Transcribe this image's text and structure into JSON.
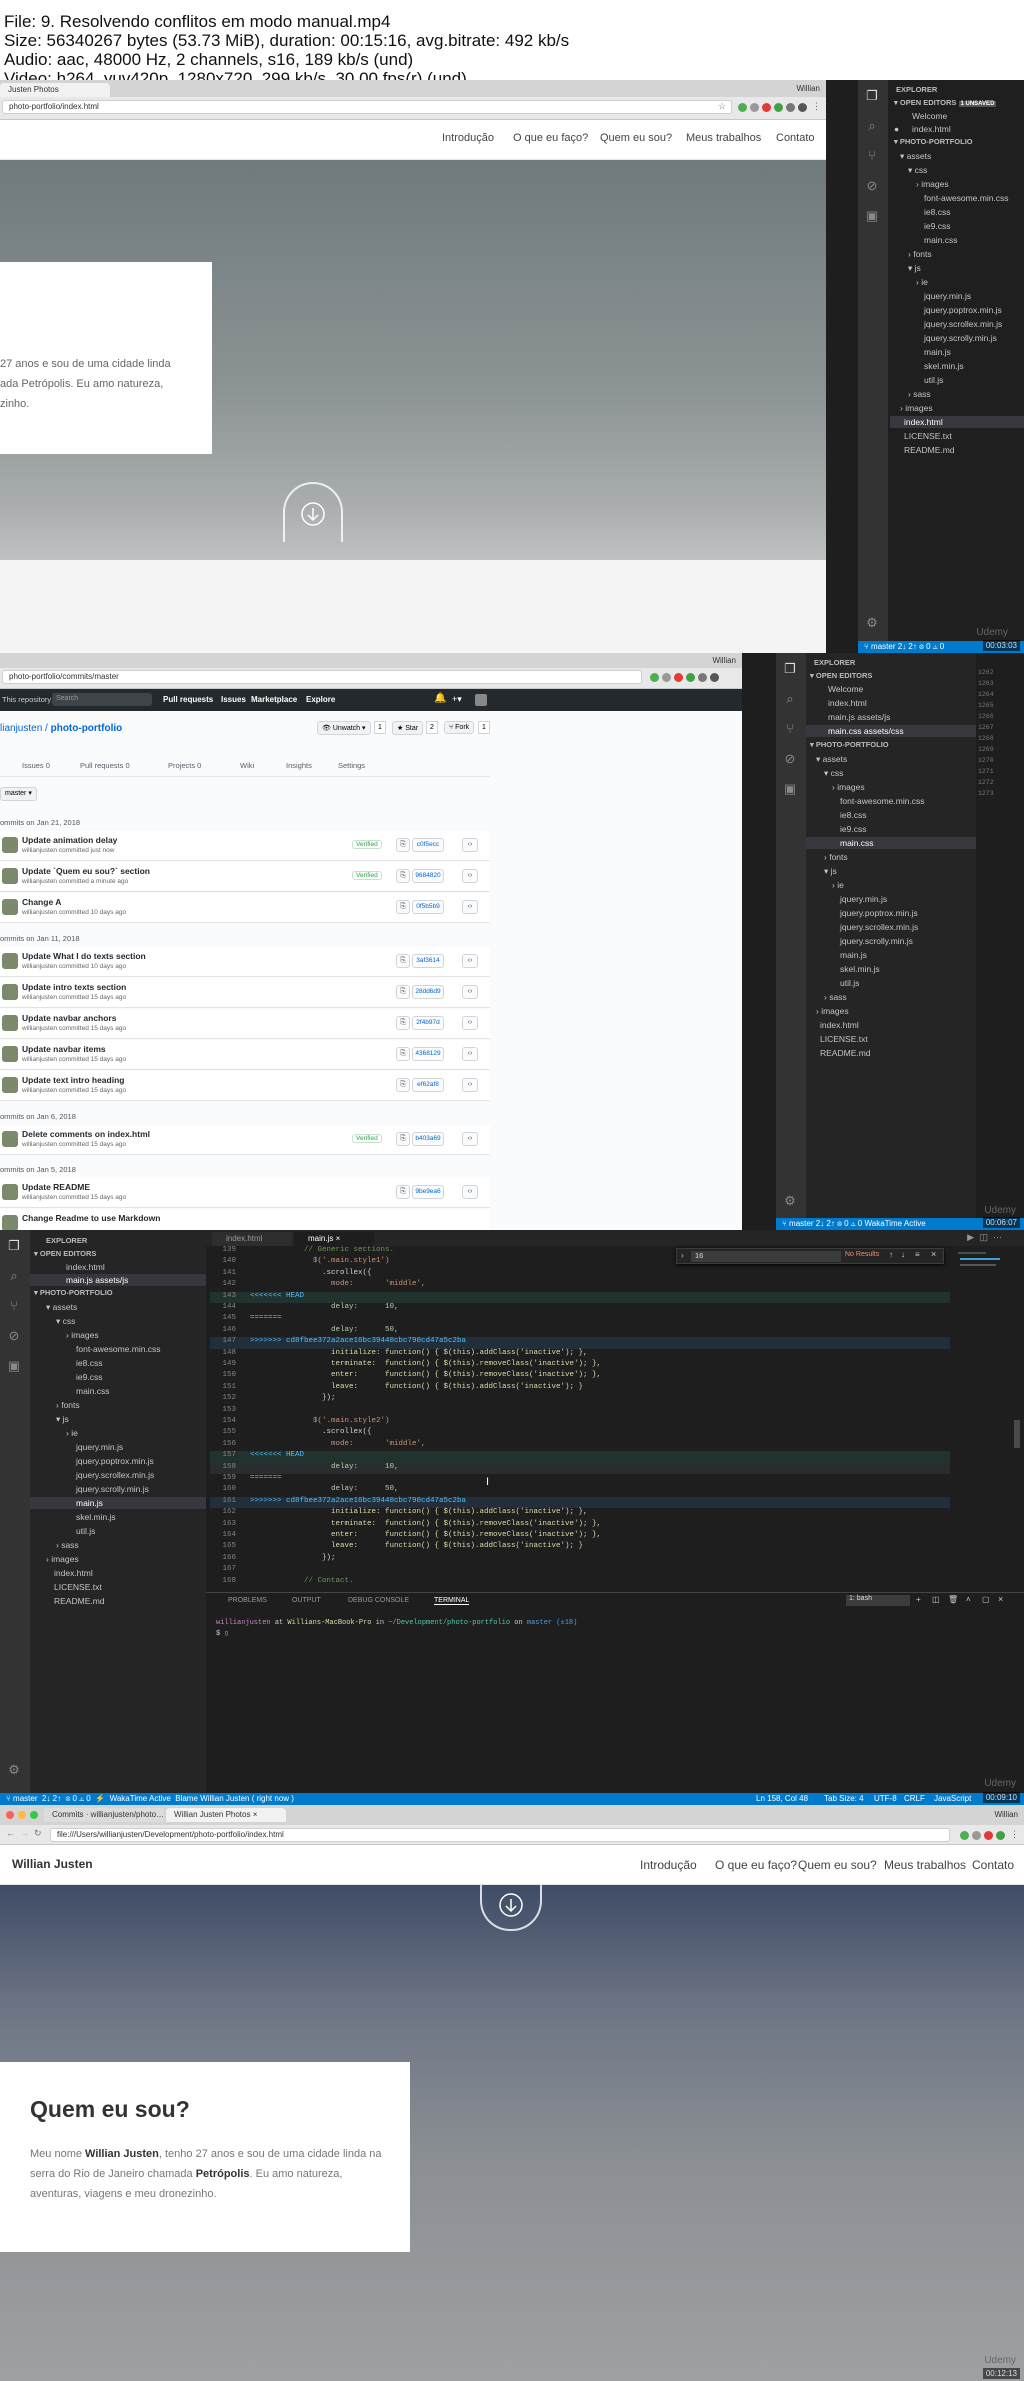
{
  "header": {
    "lines": [
      "File: 9. Resolvendo conflitos em modo manual.mp4",
      "Size: 56340267 bytes (53.73 MiB), duration: 00:15:16, avg.bitrate: 492 kb/s",
      "Audio: aac, 48000 Hz, 2 channels, s16, 189 kb/s (und)",
      "Video: h264, yuv420p, 1280x720, 299 kb/s, 30.00 fps(r) (und)"
    ]
  },
  "frame1": {
    "tab_title": "Justen Photos",
    "user": "Willian",
    "url": "photo-portfolio/index.html",
    "nav": [
      "Introdução",
      "O que eu faço?",
      "Quem eu sou?",
      "Meus trabalhos",
      "Contato"
    ],
    "card_text": "27 anos e sou de uma cidade linda ada Petrópolis. Eu amo natureza, zinho.",
    "card_lines": [
      "27 anos e sou de uma cidade linda",
      "ada Petrópolis. Eu amo natureza,",
      "zinho."
    ],
    "explorer": {
      "title": "EXPLORER",
      "open_editors": "OPEN EDITORS",
      "unsaved": "1 UNSAVED",
      "open_files": [
        "Welcome",
        "index.html"
      ],
      "project": "PHOTO-PORTFOLIO",
      "tree": [
        "assets",
        "css",
        "images",
        "font-awesome.min.css",
        "ie8.css",
        "ie9.css",
        "main.css",
        "fonts",
        "js",
        "ie",
        "jquery.min.js",
        "jquery.poptrox.min.js",
        "jquery.scrollex.min.js",
        "jquery.scrolly.min.js",
        "main.js",
        "skel.min.js",
        "util.js",
        "sass",
        "images",
        "index.html",
        "LICENSE.txt",
        "README.md"
      ]
    },
    "status": {
      "branch": "master",
      "sync": "2↓ 2↑",
      "errors": "⊗ 0 ⚠ 0"
    },
    "timestamp": "00:03:03"
  },
  "frame2": {
    "user": "Willian",
    "url": "photo-portfolio/commits/master",
    "search_scope": "This repository",
    "search_placeholder": "Search",
    "topnav": [
      "Pull requests",
      "Issues",
      "Marketplace",
      "Explore"
    ],
    "repo": "willianjusten / photo-portfolio",
    "repo_owner": "lianjusten",
    "repo_name": "photo-portfolio",
    "unwatch": "Unwatch",
    "watch_count": "1",
    "star": "Star",
    "star_count": "2",
    "fork": "Fork",
    "fork_count": "1",
    "tabs": [
      "Issues 0",
      "Pull requests 0",
      "Projects 0",
      "Wiki",
      "Insights",
      "Settings"
    ],
    "branch": "master",
    "verified_label": "Verified",
    "groups": [
      {
        "date": "ommits on Jan 21, 2018",
        "commits": [
          {
            "title": "Update animation delay",
            "sub": "willianjusten committed just now",
            "sha": "c0f5ecc",
            "verified": true
          },
          {
            "title": "Update `Quem eu sou?` section",
            "sub": "willianjusten committed a minute ago",
            "sha": "9684820",
            "verified": true
          },
          {
            "title": "Change A",
            "sub": "willianjusten committed 10 days ago",
            "sha": "0f5b5b9",
            "verified": false
          }
        ]
      },
      {
        "date": "ommits on Jan 11, 2018",
        "commits": [
          {
            "title": "Update What I do texts section",
            "sub": "willianjusten committed 10 days ago",
            "sha": "3af3614",
            "verified": false
          },
          {
            "title": "Update intro texts section",
            "sub": "willianjusten committed 15 days ago",
            "sha": "28dd6d9",
            "verified": false
          },
          {
            "title": "Update navbar anchors",
            "sub": "willianjusten committed 15 days ago",
            "sha": "2f4b97d",
            "verified": false
          },
          {
            "title": "Update navbar items",
            "sub": "willianjusten committed 15 days ago",
            "sha": "4368129",
            "verified": false
          },
          {
            "title": "Update text intro heading",
            "sub": "willianjusten committed 15 days ago",
            "sha": "ef62af8",
            "verified": false
          }
        ]
      },
      {
        "date": "ommits on Jan 6, 2018",
        "commits": [
          {
            "title": "Delete comments on index.html",
            "sub": "willianjusten committed 15 days ago",
            "sha": "b403a69",
            "verified": true
          }
        ]
      },
      {
        "date": "ommits on Jan 5, 2018",
        "commits": [
          {
            "title": "Update README",
            "sub": "willianjusten committed 15 days ago",
            "sha": "9be9ea6",
            "verified": false
          },
          {
            "title": "Change Readme to use Markdown",
            "sub": "",
            "sha": "",
            "verified": false
          }
        ]
      }
    ],
    "explorer": {
      "title": "EXPLORER",
      "open_editors": "OPEN EDITORS",
      "open_files": [
        "Welcome",
        "index.html",
        "main.js  assets/js",
        "main.css  assets/css"
      ],
      "project": "PHOTO-PORTFOLIO",
      "tree": [
        "assets",
        "css",
        "images",
        "font-awesome.min.css",
        "ie8.css",
        "ie9.css",
        "main.css",
        "fonts",
        "js",
        "ie",
        "jquery.min.js",
        "jquery.poptrox.min.js",
        "jquery.scrollex.min.js",
        "jquery.scrolly.min.js",
        "main.js",
        "skel.min.js",
        "util.js",
        "sass",
        "images",
        "index.html",
        "LICENSE.txt",
        "README.md"
      ]
    },
    "gutter": [
      "1262",
      "1263",
      "1264",
      "1265",
      "1266",
      "1267",
      "1268",
      "1269",
      "1270",
      "1271",
      "1272",
      "1273"
    ],
    "status": {
      "branch": "master",
      "sync": "2↓ 2↑",
      "errors": "⊗ 0 ⚠ 0",
      "wakatime": "WakaTime Active"
    },
    "timestamp": "00:06:07"
  },
  "frame3": {
    "tabs": [
      "index.html",
      "main.js"
    ],
    "explorer": {
      "title": "EXPLORER",
      "open_editors": "OPEN EDITORS",
      "open_files": [
        "index.html",
        "main.js  assets/js"
      ],
      "project": "PHOTO-PORTFOLIO",
      "tree": [
        "assets",
        "css",
        "images",
        "font-awesome.min.css",
        "ie8.css",
        "ie9.css",
        "main.css",
        "fonts",
        "js",
        "ie",
        "jquery.min.js",
        "jquery.poptrox.min.js",
        "jquery.scrollex.min.js",
        "jquery.scrolly.min.js",
        "main.js",
        "skel.min.js",
        "util.js",
        "sass",
        "images",
        "index.html",
        "LICENSE.txt",
        "README.md"
      ]
    },
    "find": {
      "query": "16",
      "result": "No Results"
    },
    "code_lines": [
      {
        "n": "139",
        "t": "            // Generic sections."
      },
      {
        "n": "140",
        "t": "              $('.main.style1')"
      },
      {
        "n": "141",
        "t": "                .scrollex({"
      },
      {
        "n": "142",
        "t": "                  mode:       'middle',"
      },
      {
        "n": "143",
        "t": "<<<<<<< HEAD"
      },
      {
        "n": "144",
        "t": "                  delay:      10,"
      },
      {
        "n": "145",
        "t": "======="
      },
      {
        "n": "146",
        "t": "                  delay:      50,"
      },
      {
        "n": "147",
        "t": ">>>>>>> cd8fbee372a2ace16bc39440cbc790cd47a5c2ba"
      },
      {
        "n": "148",
        "t": "                  initialize: function() { $(this).addClass('inactive'); },"
      },
      {
        "n": "149",
        "t": "                  terminate:  function() { $(this).removeClass('inactive'); },"
      },
      {
        "n": "150",
        "t": "                  enter:      function() { $(this).removeClass('inactive'); },"
      },
      {
        "n": "151",
        "t": "                  leave:      function() { $(this).addClass('inactive'); }"
      },
      {
        "n": "152",
        "t": "                });"
      },
      {
        "n": "153",
        "t": ""
      },
      {
        "n": "154",
        "t": "              $('.main.style2')"
      },
      {
        "n": "155",
        "t": "                .scrollex({"
      },
      {
        "n": "156",
        "t": "                  mode:       'middle',"
      },
      {
        "n": "157",
        "t": "<<<<<<< HEAD"
      },
      {
        "n": "158",
        "t": "                  delay:      10,"
      },
      {
        "n": "159",
        "t": "======="
      },
      {
        "n": "160",
        "t": "                  delay:      50,"
      },
      {
        "n": "161",
        "t": ">>>>>>> cd8fbee372a2ace16bc39440cbc790cd47a5c2ba"
      },
      {
        "n": "162",
        "t": "                  initialize: function() { $(this).addClass('inactive'); },"
      },
      {
        "n": "163",
        "t": "                  terminate:  function() { $(this).removeClass('inactive'); },"
      },
      {
        "n": "164",
        "t": "                  enter:      function() { $(this).removeClass('inactive'); },"
      },
      {
        "n": "165",
        "t": "                  leave:      function() { $(this).addClass('inactive'); }"
      },
      {
        "n": "166",
        "t": "                });"
      },
      {
        "n": "167",
        "t": ""
      },
      {
        "n": "168",
        "t": "            // Contact."
      }
    ],
    "panel_tabs": [
      "PROBLEMS",
      "OUTPUT",
      "DEBUG CONSOLE",
      "TERMINAL"
    ],
    "terminal_select": "1: bash",
    "prompt": {
      "user": "willianjusten",
      "at": "at",
      "host": "Willians-MacBook-Pro",
      "in": "in",
      "path": "~/Development/photo-portfolio",
      "on": "on",
      "branch": "master (±18)"
    },
    "prompt_symbol": "$",
    "status": {
      "branch": "master",
      "sync": "2↓ 2↑",
      "errors": "⊗ 0 ⚠ 0",
      "wakatime": "WakaTime Active",
      "blame": "Blame Willian Justen ( right now )",
      "pos": "Ln 158, Col 48",
      "tab": "Tab Size: 4",
      "enc": "UTF-8",
      "eol": "CRLF",
      "lang": "JavaScript"
    },
    "timestamp": "00:09:10"
  },
  "frame4": {
    "tabs": [
      "Commits · willianjusten/photo…",
      "Willian Justen Photos"
    ],
    "user": "Willian",
    "url": "file:///Users/willianjusten/Development/photo-portfolio/index.html",
    "brand": "Willian Justen",
    "nav": [
      "Introdução",
      "O que eu faço?",
      "Quem eu sou?",
      "Meus trabalhos",
      "Contato"
    ],
    "heading": "Quem eu sou?",
    "para": {
      "p1": "Meu nome ",
      "name": "Willian Justen",
      "p2": ", tenho 27 anos e sou de uma cidade linda na serra do Rio de Janeiro chamada ",
      "city": "Petrópolis",
      "p3": ". Eu amo natureza, aventuras, viagens e meu dronezinho."
    },
    "timestamp": "00:12:13"
  },
  "watermark": "Udemy"
}
